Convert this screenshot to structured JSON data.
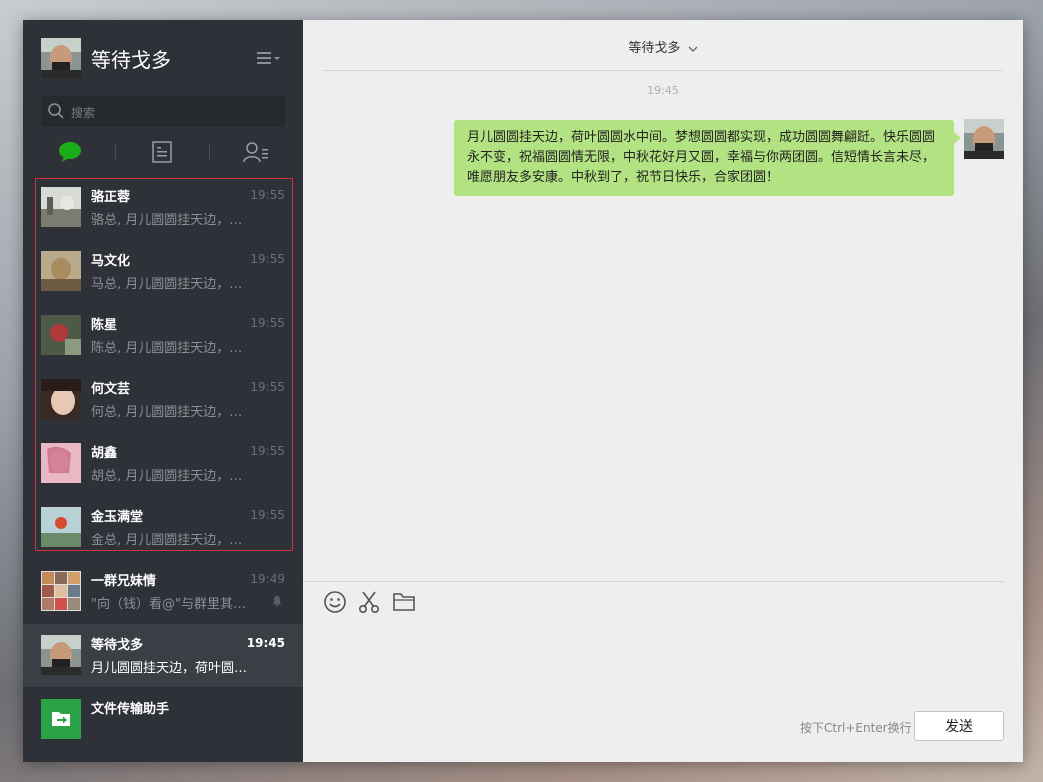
{
  "profile": {
    "name": "等待戈多"
  },
  "search": {
    "placeholder": "搜索"
  },
  "tabs": [
    "chat-icon",
    "document-icon",
    "contacts-icon"
  ],
  "conversations": [
    {
      "name": "骆正蓉",
      "time": "19:55",
      "preview": "骆总, 月儿圆圆挂天边，荷叶圆圆水中间。"
    },
    {
      "name": "马文化",
      "time": "19:55",
      "preview": "马总, 月儿圆圆挂天边，荷叶圆圆水中间。"
    },
    {
      "name": "陈星",
      "time": "19:55",
      "preview": "陈总, 月儿圆圆挂天边，荷叶圆圆水中间。"
    },
    {
      "name": "何文芸",
      "time": "19:55",
      "preview": "何总, 月儿圆圆挂天边，荷叶圆圆水中间。"
    },
    {
      "name": "胡鑫",
      "time": "19:55",
      "preview": "胡总, 月儿圆圆挂天边，荷叶圆圆水中间。"
    },
    {
      "name": "金玉满堂",
      "time": "19:55",
      "preview": "金总, 月儿圆圆挂天边，荷叶圆圆水中间。"
    },
    {
      "name": "一群兄妹情",
      "time": "19:49",
      "preview": "\"向（钱）看@\"与群里其他人都不是微信朋友关系"
    },
    {
      "name": "等待戈多",
      "time": "19:45",
      "preview": "月儿圆圆挂天边，荷叶圆圆水中间。"
    },
    {
      "name": "文件传输助手",
      "time": "",
      "preview": ""
    }
  ],
  "chat": {
    "title": "等待戈多",
    "time": "19:45",
    "message": "月儿圆圆挂天边，荷叶圆圆水中间。梦想圆圆都实现，成功圆圆舞翩跹。快乐圆圆永不变，祝福圆圆情无限，中秋花好月又圆，幸福与你两团圆。信短情长言未尽，唯愿朋友多安康。中秋到了，祝节日快乐，合家团圆！"
  },
  "composer": {
    "hint": "按下Ctrl+Enter换行",
    "send_label": "发送"
  },
  "colors": {
    "sidebar": "#2e3238",
    "bubble": "#b2e281",
    "highlight": "#d3323a",
    "accent": "#1aad19"
  }
}
